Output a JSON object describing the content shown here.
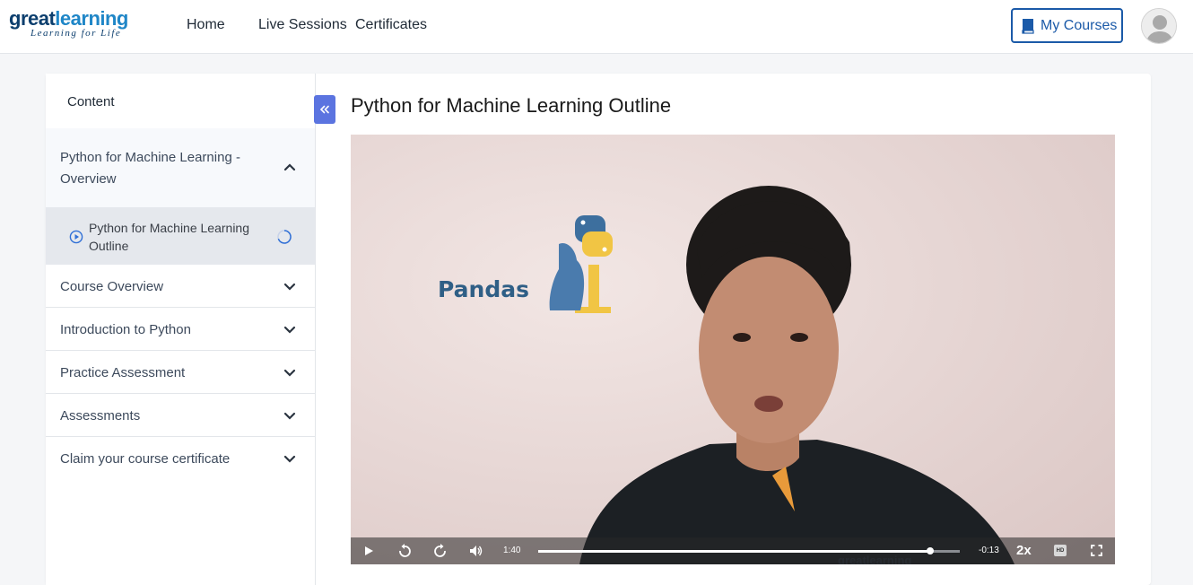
{
  "header": {
    "logo_great": "great",
    "logo_learning": "learning",
    "logo_tagline": "Learning for Life",
    "nav": [
      "Home",
      "Live Sessions",
      "Certificates"
    ],
    "my_courses": "My Courses"
  },
  "sidebar": {
    "title": "Content",
    "open_section": {
      "label": "Python for Machine Learning - Overview",
      "items": [
        {
          "label": "Python for Machine Learning Outline"
        }
      ]
    },
    "sections": [
      {
        "label": "Course Overview"
      },
      {
        "label": "Introduction to Python"
      },
      {
        "label": "Practice Assessment"
      },
      {
        "label": "Assessments"
      },
      {
        "label": "Claim your course certificate"
      }
    ]
  },
  "lesson": {
    "title": "Python for Machine Learning Outline"
  },
  "video": {
    "overlay_text": "Pandas",
    "watermark": "greatlearning",
    "elapsed": "1:40",
    "remaining": "-0:13",
    "speed": "2x",
    "progress_fraction": 0.93,
    "quality_badge": "HD"
  },
  "colors": {
    "accent": "#1b5aa8",
    "collapse_button": "#5b74e0",
    "active_item_bg": "#e5e8ed"
  }
}
